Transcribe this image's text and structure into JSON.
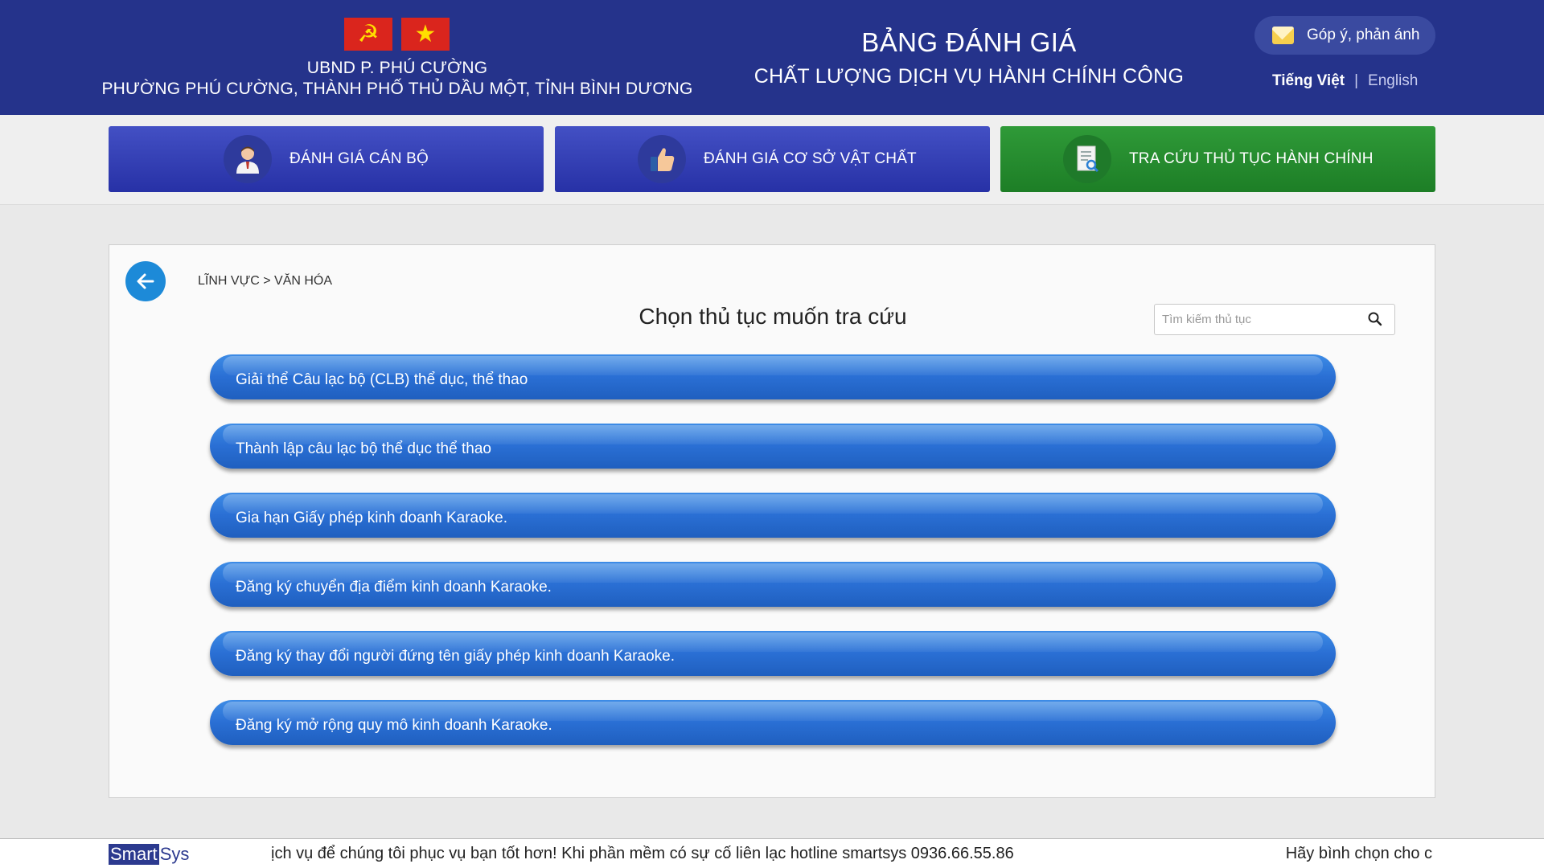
{
  "header": {
    "org_line1": "UBND P. PHÚ CƯỜNG",
    "org_line2": "PHƯỜNG PHÚ CƯỜNG, THÀNH PHỐ THỦ DẦU MỘT, TỈNH BÌNH DƯƠNG",
    "title_line1": "BẢNG ĐÁNH GIÁ",
    "title_line2": "CHẤT LƯỢNG DỊCH VỤ HÀNH CHÍNH CÔNG",
    "feedback_label": "Góp ý, phản ánh",
    "lang_active": "Tiếng Việt",
    "lang_separator": "|",
    "lang_other": "English",
    "flag_party_symbol": "☭",
    "flag_star_symbol": "★",
    "colors": {
      "header_bg": "#25338b",
      "flag_red": "#da251d",
      "flag_yellow": "#ffde00"
    }
  },
  "nav": [
    {
      "label": "ĐÁNH GIÁ CÁN BỘ",
      "icon": "officer-icon",
      "color": "#2f3bb4"
    },
    {
      "label": "ĐÁNH GIÁ CƠ SỞ VẬT CHẤT",
      "icon": "thumbs-up-icon",
      "color": "#2f3bb4"
    },
    {
      "label": "TRA CỨU THỦ TỤC HÀNH CHÍNH",
      "icon": "document-search-icon",
      "color": "#268a2f"
    }
  ],
  "main": {
    "breadcrumb": "LĨNH VỰC > VĂN HÓA",
    "title": "Chọn thủ tục muốn tra cứu",
    "search_placeholder": "Tìm kiếm thủ tục",
    "procedures": [
      "Giải thể Câu lạc bộ (CLB) thể dục, thể thao",
      "Thành lập câu lạc bộ thể dục thể thao",
      "Gia hạn Giấy phép kinh doanh Karaoke.",
      "Đăng ký chuyển địa điểm kinh doanh Karaoke.",
      "Đăng ký thay đổi người đứng tên giấy phép kinh doanh Karaoke.",
      "Đăng ký mở rộng quy mô kinh doanh Karaoke."
    ],
    "colors": {
      "procedure_button": "#2a6fd4",
      "back_button": "#1d8ad8"
    }
  },
  "footer": {
    "logo_smart": "Smart",
    "logo_sys": "Sys",
    "ticker_text": "ịch vụ để chúng tôi phục vụ bạn tốt hơn! Khi phần mềm có sự cố liên lạc hotline smartsys 0936.66.55.86",
    "ticker_text_2": "Hãy bình chọn cho c"
  }
}
